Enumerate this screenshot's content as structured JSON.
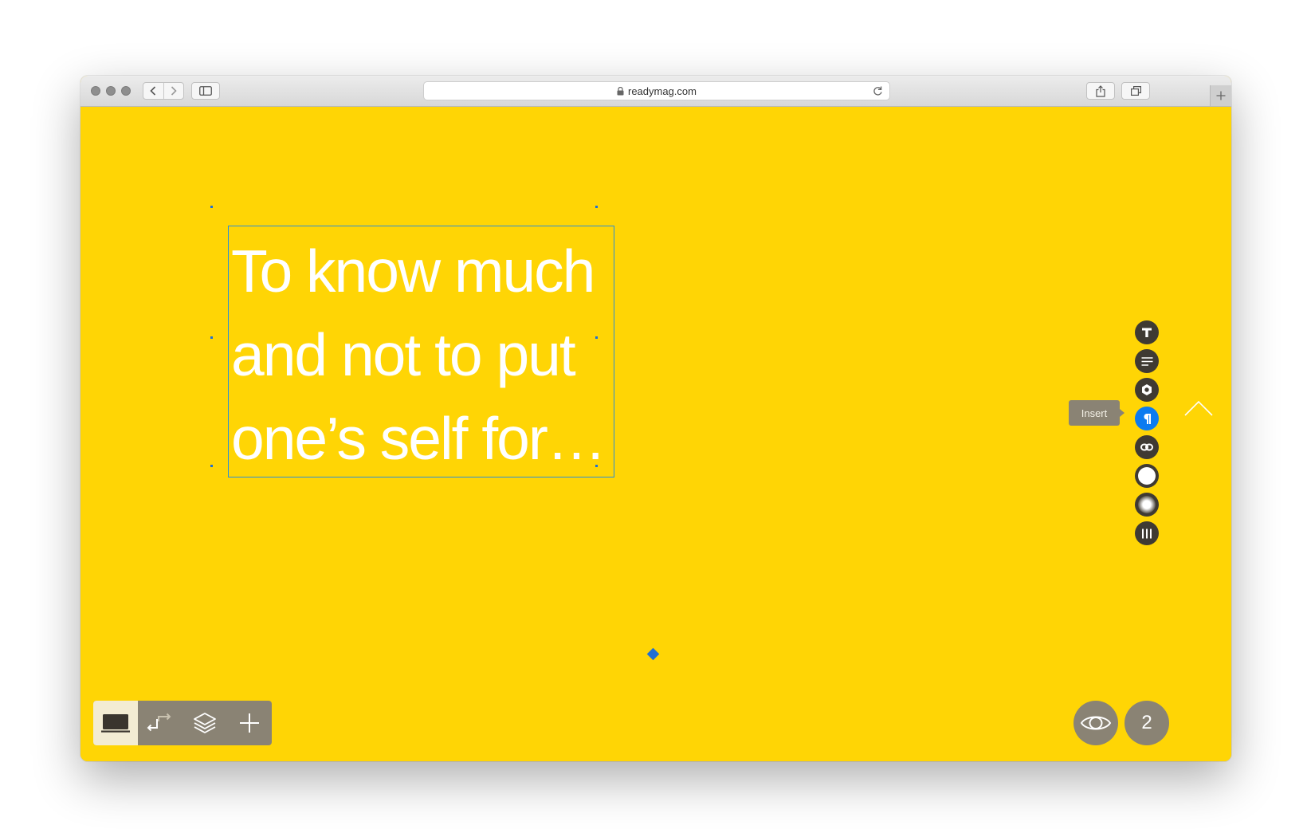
{
  "browser": {
    "url": "readymag.com"
  },
  "editor": {
    "headline": "To know much and not to put one’s self for…",
    "tooltip": "Insert",
    "page_number": "2"
  },
  "side_tools": [
    {
      "name": "text-tool",
      "icon": "text-t-icon"
    },
    {
      "name": "paragraph-align-tool",
      "icon": "align-lines-icon"
    },
    {
      "name": "settings-tool",
      "icon": "hex-settings-icon"
    },
    {
      "name": "insert-paragraph-tool",
      "icon": "pilcrow-icon",
      "active": true
    },
    {
      "name": "link-tool",
      "icon": "link-chain-icon"
    },
    {
      "name": "fill-tool",
      "icon": "circle-fill-icon"
    },
    {
      "name": "shadow-tool",
      "icon": "radial-shadow-icon"
    },
    {
      "name": "columns-tool",
      "icon": "columns-icon"
    }
  ],
  "colors": {
    "canvas": "#FFD505",
    "selection": "#2b8fd6",
    "active_tool": "#0b7bf0",
    "toolbar": "#8a8374"
  }
}
